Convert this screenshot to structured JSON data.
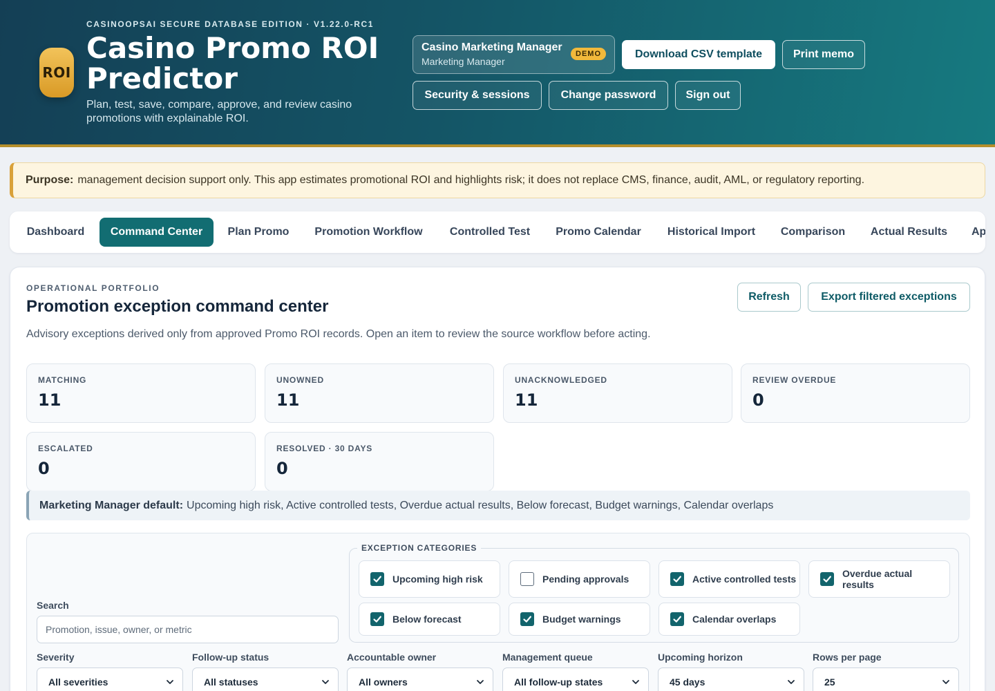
{
  "header": {
    "edition": "CASINOOPSAI SECURE DATABASE EDITION · V1.22.0-RC1",
    "logo_text": "ROI",
    "title": "Casino Promo ROI Predictor",
    "subtitle": "Plan, test, save, compare, approve, and review casino promotions with explainable ROI.",
    "user_name": "Casino Marketing Manager",
    "user_role": "Marketing Manager",
    "demo_badge": "DEMO",
    "download_csv": "Download CSV template",
    "print_memo": "Print memo",
    "security_sessions": "Security & sessions",
    "change_password": "Change password",
    "sign_out": "Sign out"
  },
  "purpose": {
    "label": "Purpose:",
    "text": "management decision support only. This app estimates promotional ROI and highlights risk; it does not replace CMS, finance, audit, AML, or regulatory reporting."
  },
  "tabs": [
    {
      "label": "Dashboard",
      "active": false
    },
    {
      "label": "Command Center",
      "active": true
    },
    {
      "label": "Plan Promo",
      "active": false
    },
    {
      "label": "Promotion Workflow",
      "active": false
    },
    {
      "label": "Controlled Test",
      "active": false
    },
    {
      "label": "Promo Calendar",
      "active": false
    },
    {
      "label": "Historical Import",
      "active": false
    },
    {
      "label": "Comparison",
      "active": false
    },
    {
      "label": "Actual Results",
      "active": false
    },
    {
      "label": "Ap",
      "active": false
    }
  ],
  "main": {
    "eyebrow": "OPERATIONAL PORTFOLIO",
    "title": "Promotion exception command center",
    "description": "Advisory exceptions derived only from approved Promo ROI records. Open an item to review the source workflow before acting.",
    "refresh": "Refresh",
    "export": "Export filtered exceptions",
    "stats": [
      {
        "label": "MATCHING",
        "value": "11"
      },
      {
        "label": "UNOWNED",
        "value": "11"
      },
      {
        "label": "UNACKNOWLEDGED",
        "value": "11"
      },
      {
        "label": "REVIEW OVERDUE",
        "value": "0"
      },
      {
        "label": "ESCALATED",
        "value": "0"
      },
      {
        "label": "RESOLVED · 30 DAYS",
        "value": "0"
      }
    ],
    "default_note_label": "Marketing Manager default:",
    "default_note_text": "Upcoming high risk, Active controlled tests, Overdue actual results, Below forecast, Budget warnings, Calendar overlaps"
  },
  "filters": {
    "search_label": "Search",
    "search_placeholder": "Promotion, issue, owner, or metric",
    "search_value": "",
    "categories_legend": "EXCEPTION CATEGORIES",
    "categories": [
      {
        "label": "Upcoming high risk",
        "checked": true
      },
      {
        "label": "Pending approvals",
        "checked": false
      },
      {
        "label": "Active controlled tests",
        "checked": true
      },
      {
        "label": "Overdue actual results",
        "checked": true
      },
      {
        "label": "Below forecast",
        "checked": true
      },
      {
        "label": "Budget warnings",
        "checked": true
      },
      {
        "label": "Calendar overlaps",
        "checked": true
      }
    ],
    "selects": [
      {
        "label": "Severity",
        "value": "All severities"
      },
      {
        "label": "Follow-up status",
        "value": "All statuses"
      },
      {
        "label": "Accountable owner",
        "value": "All owners"
      },
      {
        "label": "Management queue",
        "value": "All follow-up states"
      },
      {
        "label": "Upcoming horizon",
        "value": "45 days"
      },
      {
        "label": "Rows per page",
        "value": "25"
      }
    ]
  },
  "colors": {
    "accent": "#126d72",
    "header_gold": "#b58f2b",
    "logo_gold": "#e8ad3a",
    "purpose_border": "#d9a13a"
  },
  "icons": {
    "check": "check-icon",
    "select_arrow": "chevron-down-icon"
  }
}
